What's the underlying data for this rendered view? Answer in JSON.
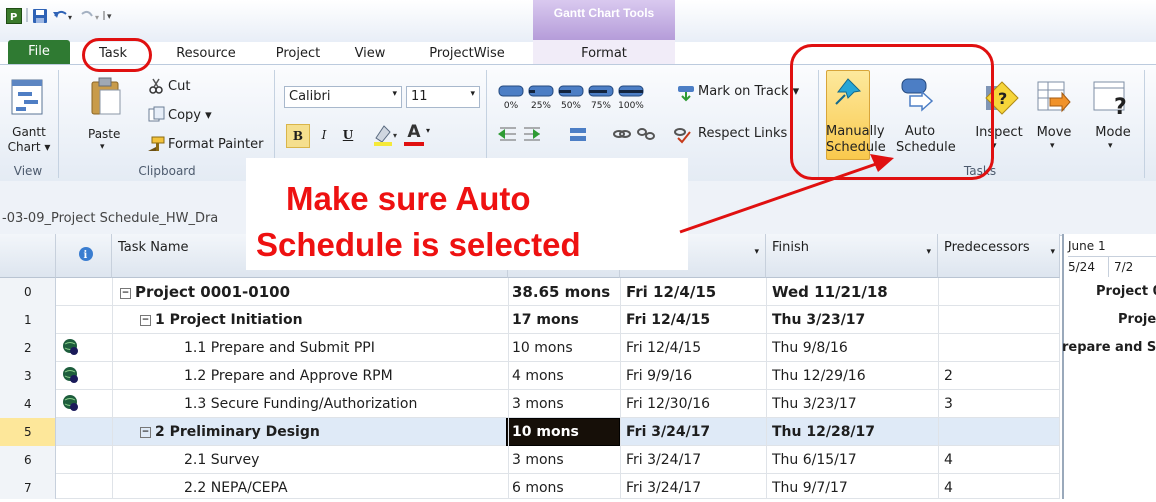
{
  "quick_access": {
    "app_icon": "project-app-icon",
    "save_icon": "save-icon",
    "undo_icon": "undo-icon",
    "redo_icon": "redo-icon"
  },
  "contextual_tab_group": "Gantt Chart Tools",
  "tabs": [
    "File",
    "Task",
    "Resource",
    "Project",
    "View",
    "ProjectWise",
    "Format"
  ],
  "ribbon": {
    "view": {
      "gantt_label": "Gantt",
      "chart_label": "Chart ▾",
      "group": "View"
    },
    "clipboard": {
      "paste": "Paste",
      "cut": "Cut",
      "copy": "Copy ▾",
      "format_painter": "Format Painter",
      "group": "Clipboard"
    },
    "font": {
      "name": "Calibri",
      "size": "11",
      "bold": "B",
      "italic": "I",
      "underline": "U",
      "font_color_letter": "A"
    },
    "schedule": {
      "pcts": [
        "0%",
        "25%",
        "50%",
        "75%",
        "100%"
      ],
      "mark_on_track": "Mark on Track ▾",
      "respect_links": "Respect Links"
    },
    "tasks": {
      "manually_1": "Manually",
      "manually_2": "Schedule",
      "auto_1": "Auto",
      "auto_2": "Schedule",
      "inspect": "Inspect",
      "move": "Move",
      "mode": "Mode",
      "group": "Tasks"
    }
  },
  "project_path": "-03-09_Project Schedule_HW_Dra",
  "callout": {
    "line1": "Make sure Auto",
    "line2": "Schedule is selected"
  },
  "columns": {
    "info": "i",
    "task_name": "Task Name",
    "finish": "Finish",
    "predecessors": "Predecessors"
  },
  "rows": [
    {
      "id": "0",
      "name": "Project 0001-0100",
      "duration": "38.65 mons",
      "start": "Fri 12/4/15",
      "finish": "Wed 11/21/18",
      "pred": ""
    },
    {
      "id": "1",
      "name": "1 Project Initiation",
      "duration": "17 mons",
      "start": "Fri 12/4/15",
      "finish": "Thu 3/23/17",
      "pred": ""
    },
    {
      "id": "2",
      "name": "1.1 Prepare and Submit PPI",
      "duration": "10 mons",
      "start": "Fri 12/4/15",
      "finish": "Thu 9/8/16",
      "pred": ""
    },
    {
      "id": "3",
      "name": "1.2 Prepare and Approve RPM",
      "duration": "4 mons",
      "start": "Fri 9/9/16",
      "finish": "Thu 12/29/16",
      "pred": "2"
    },
    {
      "id": "4",
      "name": "1.3 Secure Funding/Authorization",
      "duration": "3 mons",
      "start": "Fri 12/30/16",
      "finish": "Thu 3/23/17",
      "pred": "3"
    },
    {
      "id": "5",
      "name": "2 Preliminary Design",
      "duration": "10 mons",
      "start": "Fri 3/24/17",
      "finish": "Thu 12/28/17",
      "pred": ""
    },
    {
      "id": "6",
      "name": "2.1 Survey",
      "duration": "3 mons",
      "start": "Fri 3/24/17",
      "finish": "Thu 6/15/17",
      "pred": "4"
    },
    {
      "id": "7",
      "name": "2.2 NEPA/CEPA",
      "duration": "6 mons",
      "start": "Fri 3/24/17",
      "finish": "Thu 9/7/17",
      "pred": "4"
    }
  ],
  "timeline": {
    "month": "June 1",
    "weeks": [
      "5/24",
      "7/2"
    ],
    "labels": [
      "Project 00",
      "Project",
      "repare and S"
    ]
  },
  "colors": {
    "highlight_red": "#e01010",
    "file_tab_green": "#2f7a32",
    "selected_row": "#fde79a",
    "active_cell_bg": "#000000"
  }
}
